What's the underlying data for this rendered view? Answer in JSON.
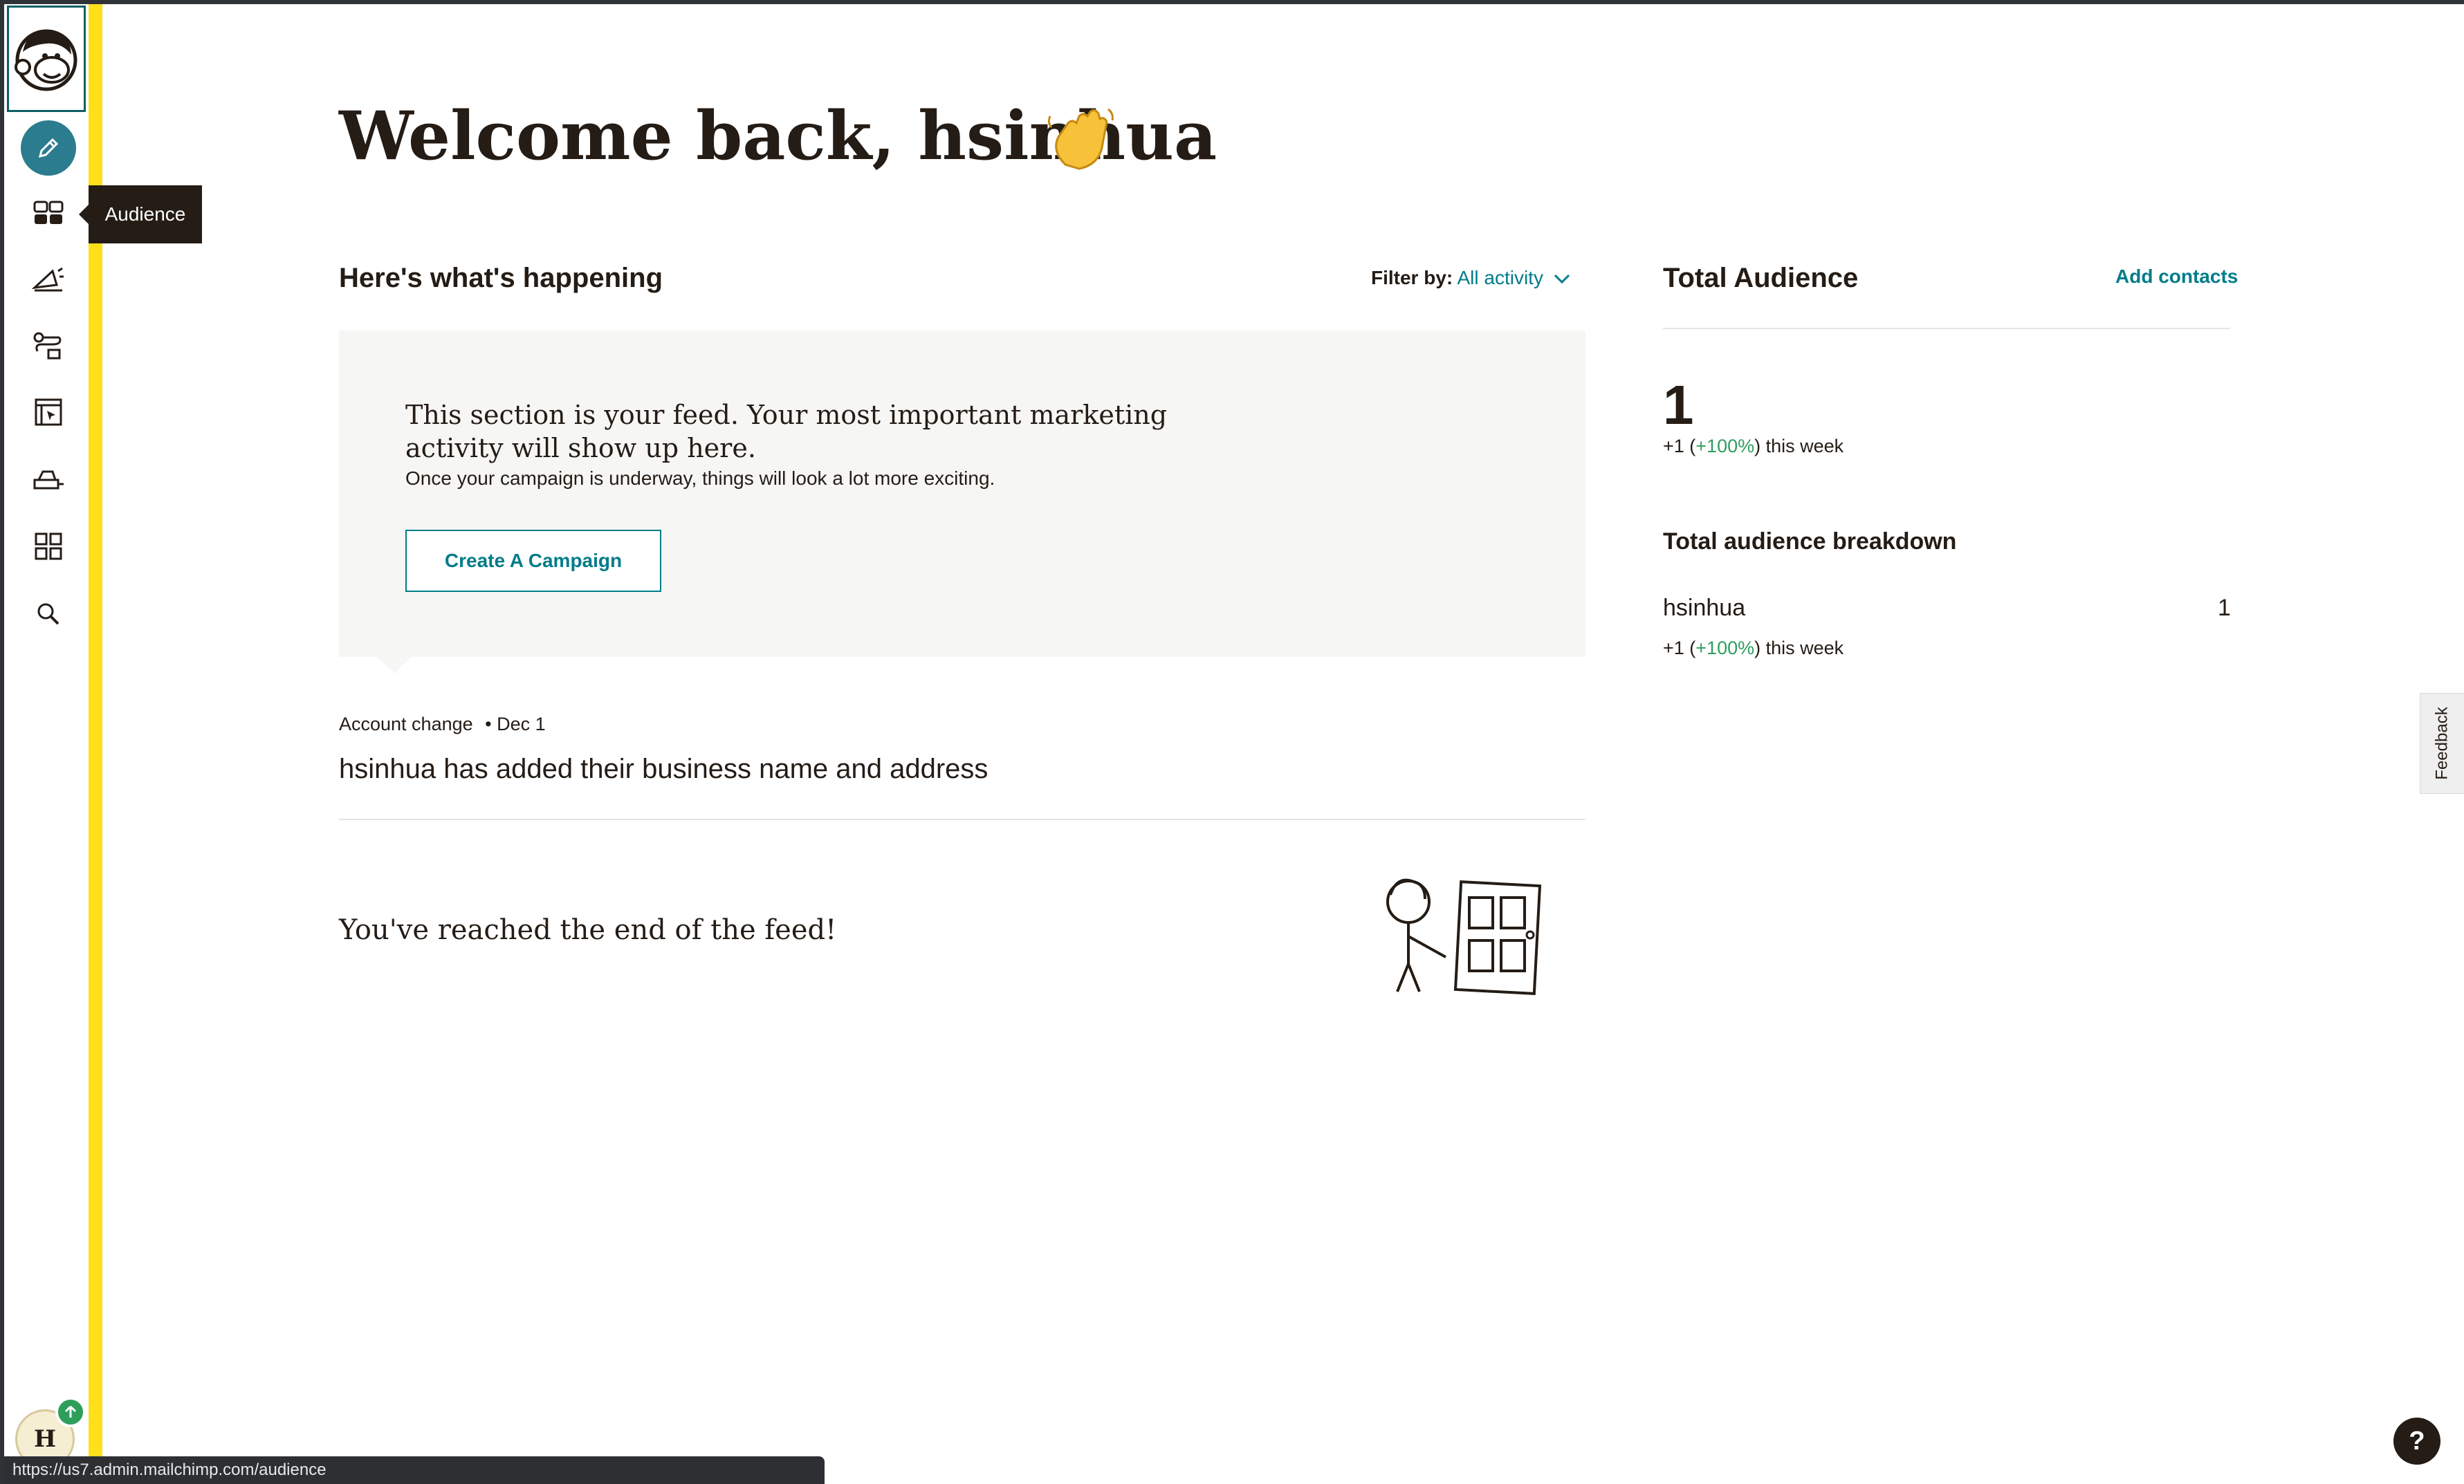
{
  "sidebar": {
    "logo_icon": "freddie-logo-icon",
    "items": [
      {
        "name": "create",
        "icon": "pencil-icon"
      },
      {
        "name": "audience",
        "icon": "audience-icon"
      },
      {
        "name": "campaigns",
        "icon": "megaphone-icon"
      },
      {
        "name": "automations",
        "icon": "automation-icon"
      },
      {
        "name": "website",
        "icon": "website-icon"
      },
      {
        "name": "content",
        "icon": "content-studio-icon"
      },
      {
        "name": "integrations",
        "icon": "grid-icon"
      },
      {
        "name": "search",
        "icon": "search-icon"
      }
    ],
    "tooltip": "Audience",
    "avatar_initial": "H"
  },
  "header": {
    "welcome": "Welcome back, hsinhua",
    "wave_emoji": "👋"
  },
  "feed": {
    "title": "Here's what's happening",
    "filter_label": "Filter by:",
    "filter_value": "All activity",
    "intro_title": "This section is your feed. Your most important marketing activity will show up here.",
    "intro_sub": "Once your campaign is underway, things will look a lot more exciting.",
    "create_button": "Create A Campaign",
    "event_type": "Account change",
    "event_date": "• Dec 1",
    "event_text": "hsinhua has added their business name and address",
    "end_text": "You've reached the end of the feed!"
  },
  "audience": {
    "title": "Total Audience",
    "add_contacts": "Add contacts",
    "total": "1",
    "week_prefix": "+1 (",
    "week_pct": "+100%",
    "week_suffix": ") this week",
    "breakdown_title": "Total audience breakdown",
    "breakdown": [
      {
        "name": "hsinhua",
        "count": "1"
      }
    ]
  },
  "widgets": {
    "feedback": "Feedback",
    "help": "?"
  },
  "statusbar": {
    "url": "https://us7.admin.mailchimp.com/audience"
  },
  "colors": {
    "accent": "#007c89",
    "sidebar_stripe": "#ffe01b",
    "positive": "#2e9e5b"
  }
}
